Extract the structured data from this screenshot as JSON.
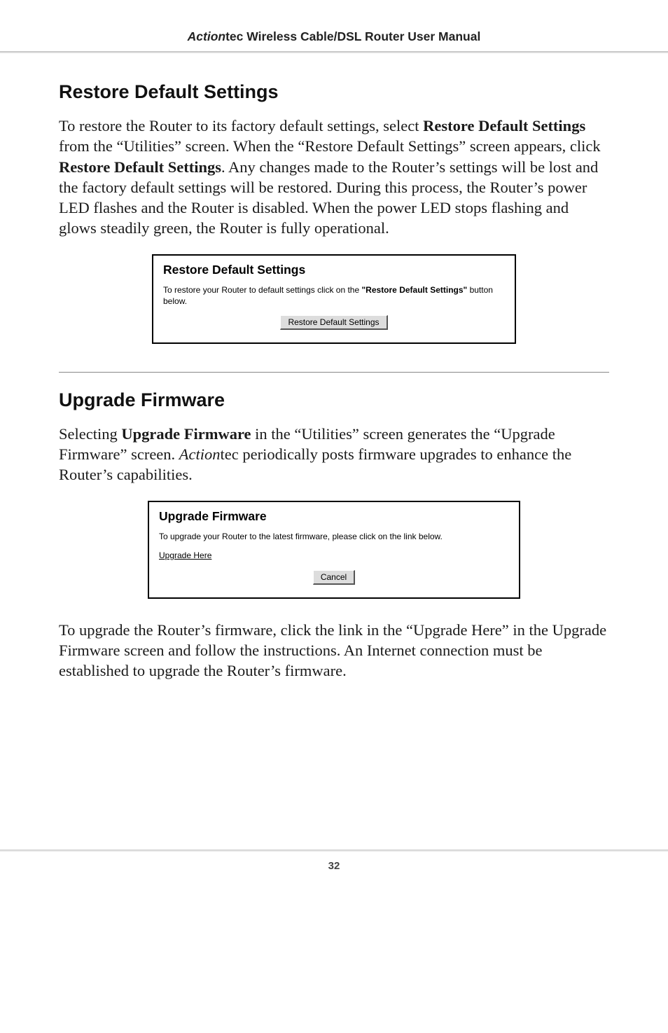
{
  "header": {
    "brand_italic": "Action",
    "brand_rest": "tec",
    "title_rest": " Wireless Cable/DSL Router User Manual"
  },
  "section1": {
    "heading": "Restore Default Settings",
    "para_prefix": " To restore the Router to its factory default settings, select ",
    "bold1": "Restore Default Settings",
    "mid1": " from the “Utilities” screen. When the “Restore Default Settings” screen appears, click ",
    "bold2": "Restore Default Settings",
    "suffix": ". Any changes made to the Router’s settings will be lost and the factory default settings will be restored. During this process, the Router’s power LED flashes and the Router is disabled. When the power LED stops flashing and glows steadily green, the Router is fully operational."
  },
  "restore_box": {
    "title": "Restore Default Settings",
    "text_prefix": "To restore your Router to default settings click on the ",
    "text_bold": "\"Restore Default Settings\"",
    "text_suffix": " button below.",
    "button": "Restore Default Settings"
  },
  "section2": {
    "heading": "Upgrade Firmware",
    "para_prefix": "Selecting ",
    "bold1": "Upgrade Firmware",
    "mid1": " in the “Utilities” screen generates the “Upgrade Firmware” screen. ",
    "italic1": "Action",
    "suffix": "tec periodically posts firmware upgrades to enhance the Router’s capabilities."
  },
  "upgrade_box": {
    "title": "Upgrade Firmware",
    "text": "To upgrade your Router to the latest firmware, please click on the link below.",
    "link": "Upgrade Here",
    "button": "Cancel"
  },
  "para3": "To upgrade the Router’s firmware, click the link in the “Upgrade Here” in the Upgrade Firmware screen and follow the instructions. An Internet connection must be established to upgrade the Router’s firmware.",
  "footer": {
    "page_number": "32"
  }
}
